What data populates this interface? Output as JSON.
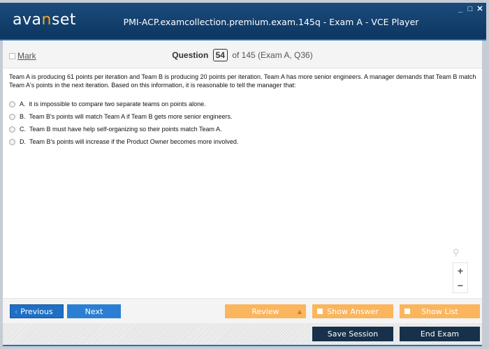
{
  "window": {
    "logo_prefix": "ava",
    "logo_accent": "n",
    "logo_suffix": "set",
    "title": "PMI-ACP.examcollection.premium.exam.145q - Exam A - VCE Player",
    "controls": {
      "minimize": "_",
      "maximize": "□",
      "close": "✕"
    }
  },
  "header": {
    "mark_label": "Mark",
    "question_label": "Question",
    "question_number": "54",
    "question_of": "of 145 (Exam A, Q36)"
  },
  "question": {
    "text": "Team A is producing 61 points per iteration and Team B is producing 20 points per iteration. Team A has more senior engineers. A manager demands that Team B match Team A's points in the next iteration. Based on this information, it is reasonable to tell the manager that:",
    "options": [
      {
        "letter": "A.",
        "text": "it is impossible to compare two separate teams on points alone."
      },
      {
        "letter": "B.",
        "text": "Team B's points will match Team A if Team B gets more senior engineers."
      },
      {
        "letter": "C.",
        "text": "Team B must have help self-organizing so their points match Team A."
      },
      {
        "letter": "D.",
        "text": "Team B's points will increase if the Product Owner becomes more involved."
      }
    ]
  },
  "zoom": {
    "search_icon": "⚲",
    "plus": "+",
    "minus": "−"
  },
  "nav": {
    "previous_label": "Previous",
    "next_label": "Next",
    "review_label": "Review",
    "show_answer_label": "Show Answer",
    "show_list_label": "Show List"
  },
  "footer": {
    "save_session_label": "Save Session",
    "end_exam_label": "End Exam"
  },
  "colors": {
    "titlebar": "#0d3661",
    "primary_button": "#2b7fd3",
    "orange_button": "#fbb55c",
    "dark_button": "#163149",
    "logo_accent": "#f5a623"
  }
}
